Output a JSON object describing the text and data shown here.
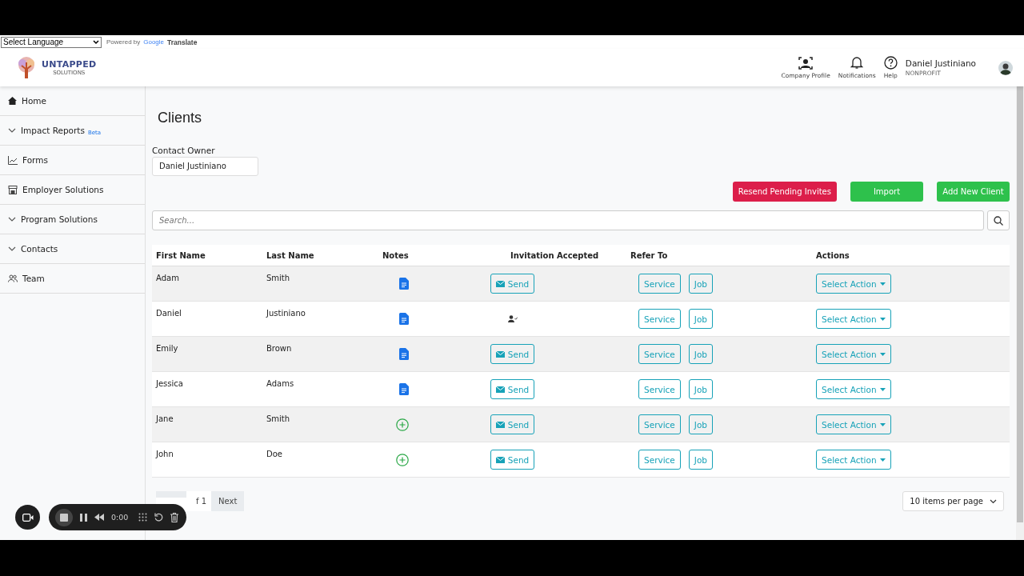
{
  "translate_bar": {
    "language_select": "Select Language",
    "powered_by": "Powered by",
    "google": "Google",
    "translate": "Translate"
  },
  "header": {
    "logo_title": "UNTAPPED",
    "logo_subtitle": "SOLUTIONS",
    "icons": [
      {
        "kind": "profile",
        "label": "Company Profile"
      },
      {
        "kind": "bell",
        "label": "Notifications"
      },
      {
        "kind": "help",
        "label": "Help"
      }
    ],
    "user_name": "Daniel Justiniano",
    "user_role": "NONPROFIT"
  },
  "sidebar": {
    "items": [
      {
        "kind": "home",
        "label": "Home"
      },
      {
        "kind": "chevron",
        "label": "Impact Reports",
        "badge": "Beta"
      },
      {
        "kind": "chart",
        "label": "Forms"
      },
      {
        "kind": "store",
        "label": "Employer Solutions"
      },
      {
        "kind": "chevron",
        "label": "Program Solutions"
      },
      {
        "kind": "chevron",
        "label": "Contacts"
      },
      {
        "kind": "team",
        "label": "Team"
      }
    ]
  },
  "page_title": "Clients",
  "contact_owner": {
    "label": "Contact Owner",
    "value": "Daniel Justiniano"
  },
  "buttons": [
    {
      "kind": "danger",
      "label": "Resend Pending Invites"
    },
    {
      "kind": "success",
      "label": "Import"
    },
    {
      "kind": "success",
      "label": "Add New Client"
    }
  ],
  "search": {
    "placeholder": "Search..."
  },
  "table": {
    "columns": [
      "First Name",
      "Last Name",
      "Notes",
      "Invitation Accepted",
      "Refer To",
      "Actions"
    ],
    "rows": [
      {
        "first": "Adam",
        "last": "Smith",
        "notes": {
          "kind": "document"
        },
        "invitation": {
          "kind": "send",
          "label": "Send"
        },
        "refer": [
          "Service",
          "Job"
        ],
        "action": "Select Action"
      },
      {
        "first": "Daniel",
        "last": "Justiniano",
        "notes": {
          "kind": "document"
        },
        "invitation": {
          "kind": "accepted"
        },
        "refer": [
          "Service",
          "Job"
        ],
        "action": "Select Action"
      },
      {
        "first": "Emily",
        "last": "Brown",
        "notes": {
          "kind": "document"
        },
        "invitation": {
          "kind": "send",
          "label": "Send"
        },
        "refer": [
          "Service",
          "Job"
        ],
        "action": "Select Action"
      },
      {
        "first": "Jessica",
        "last": "Adams",
        "notes": {
          "kind": "document"
        },
        "invitation": {
          "kind": "send",
          "label": "Send"
        },
        "refer": [
          "Service",
          "Job"
        ],
        "action": "Select Action"
      },
      {
        "first": "Jane",
        "last": "Smith",
        "notes": {
          "kind": "add"
        },
        "invitation": {
          "kind": "send",
          "label": "Send"
        },
        "refer": [
          "Service",
          "Job"
        ],
        "action": "Select Action"
      },
      {
        "first": "John",
        "last": "Doe",
        "notes": {
          "kind": "add"
        },
        "invitation": {
          "kind": "send",
          "label": "Send"
        },
        "refer": [
          "Service",
          "Job"
        ],
        "action": "Select Action"
      }
    ]
  },
  "pagination": {
    "page_info": "f 1",
    "next": "Next",
    "per_page": "10 items per page"
  },
  "recorder": {
    "time": "0:00"
  }
}
